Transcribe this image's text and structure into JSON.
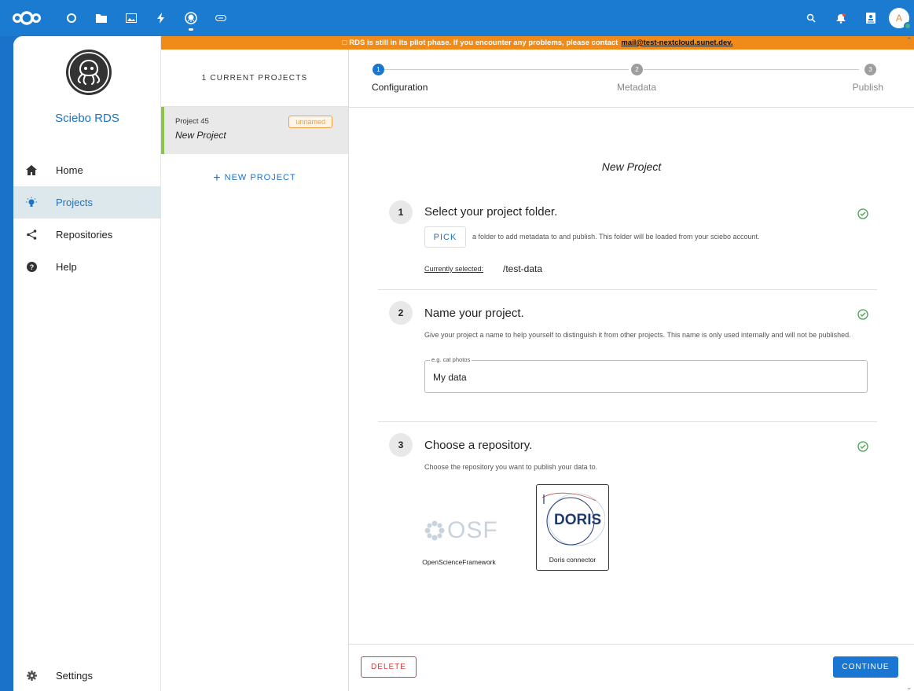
{
  "topbar": {
    "apps": [
      {
        "icon": "dashboard-circle-icon"
      },
      {
        "icon": "files-folder-icon"
      },
      {
        "icon": "photos-icon"
      },
      {
        "icon": "activity-bolt-icon"
      },
      {
        "icon": "sciebo-rds-icon"
      },
      {
        "icon": "link-icon"
      }
    ],
    "avatar_letter": "A",
    "colors": {
      "bar": "#1b7bd1",
      "accent": "#1a73c9",
      "banner": "#f08a18"
    }
  },
  "banner": {
    "text": "RDS is still in its pilot phase. If you encounter any problems, please contact",
    "email": "mail@test-nextcloud.sunet.dev."
  },
  "sidebar": {
    "title": "Sciebo RDS",
    "items": [
      {
        "label": "Home",
        "icon": "home-icon"
      },
      {
        "label": "Projects",
        "icon": "lightbulb-icon"
      },
      {
        "label": "Repositories",
        "icon": "share-icon"
      },
      {
        "label": "Help",
        "icon": "help-icon"
      }
    ],
    "settings_label": "Settings"
  },
  "projects": {
    "header": "1 CURRENT PROJECTS",
    "items": [
      {
        "id_label": "Project 45",
        "name": "New Project",
        "badge": "unnamed"
      }
    ],
    "new_label": "NEW PROJECT"
  },
  "stepper": {
    "steps": [
      {
        "num": "1",
        "label": "Configuration"
      },
      {
        "num": "2",
        "label": "Metadata"
      },
      {
        "num": "3",
        "label": "Publish"
      }
    ]
  },
  "main": {
    "title": "New Project",
    "section1": {
      "num": "1",
      "title": "Select your project folder.",
      "pick_label": "PICK",
      "pick_desc": "a folder to add metadata to and publish. This folder will be loaded from your sciebo account.",
      "selected_label": "Currently selected:",
      "selected_value": "/test-data"
    },
    "section2": {
      "num": "2",
      "title": "Name your project.",
      "desc": "Give your project a name to help yourself to distinguish it from other projects. This name is only used internally and will not be published.",
      "field_label": "e.g. cat photos",
      "field_value": "My data"
    },
    "section3": {
      "num": "3",
      "title": "Choose a repository.",
      "desc": "Choose the repository you want to publish your data to.",
      "repos": [
        {
          "logo_text": "OSF",
          "name": "OpenScienceFramework"
        },
        {
          "logo_text": "DORIS",
          "name": "Doris connector"
        }
      ]
    }
  },
  "footer": {
    "delete_label": "DELETE",
    "continue_label": "CONTINUE"
  }
}
